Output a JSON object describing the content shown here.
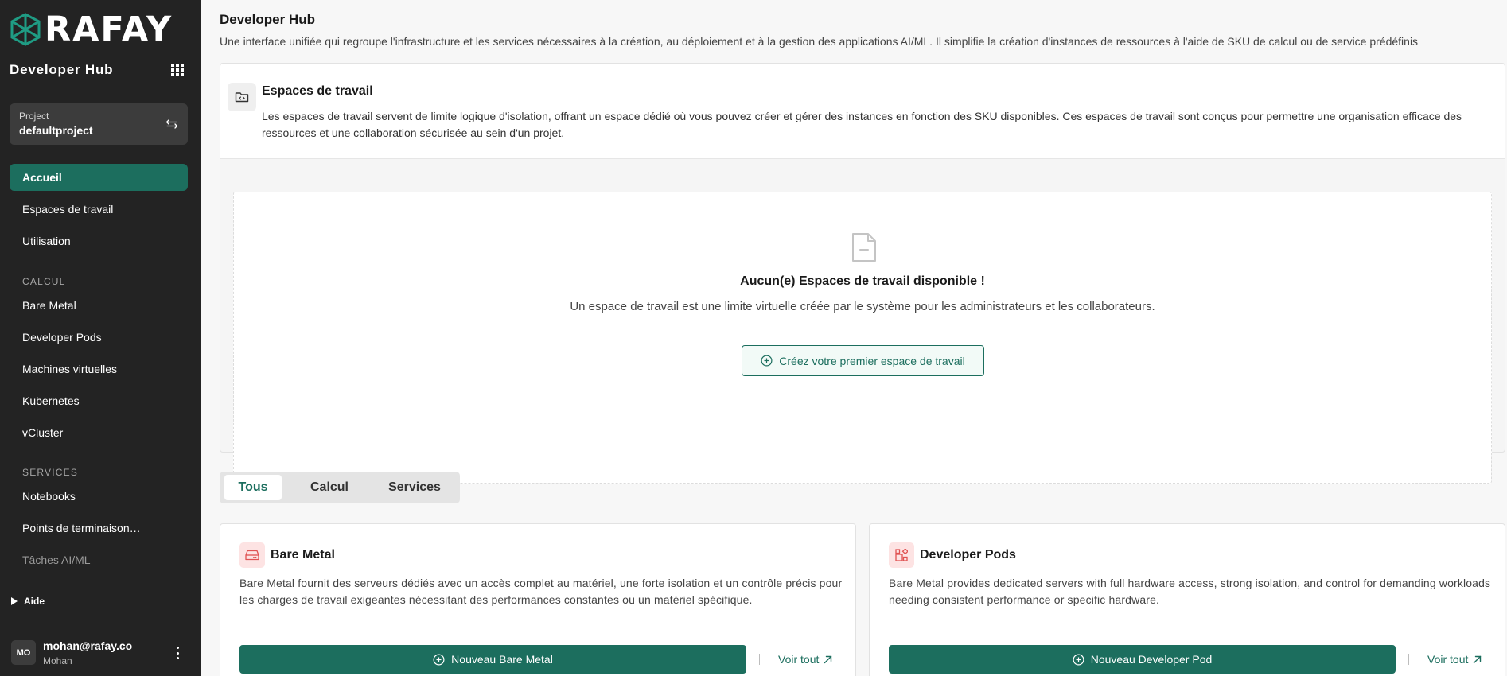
{
  "sidebar": {
    "logo_text": "RAFAY",
    "hub_title": "Developer Hub",
    "project": {
      "label": "Project",
      "value": "defaultproject"
    },
    "nav": {
      "home": "Accueil",
      "workspaces": "Espaces de travail",
      "usage": "Utilisation"
    },
    "compute_section": "CALCUL",
    "compute_items": [
      "Bare Metal",
      "Developer Pods",
      "Machines virtuelles",
      "Kubernetes",
      "vCluster"
    ],
    "services_section": "SERVICES",
    "services_items": [
      "Notebooks",
      "Points de terminaison…",
      "Tâches AI/ML"
    ],
    "help": "Aide",
    "user": {
      "initials": "MO",
      "email": "mohan@rafay.co",
      "name": "Mohan"
    }
  },
  "header": {
    "title": "Developer Hub",
    "description": "Une interface unifiée qui regroupe l'infrastructure et les services nécessaires à la création, au déploiement et à la gestion des applications AI/ML. Il simplifie la création d'instances de ressources à l'aide de SKU de calcul ou de service prédéfinis"
  },
  "workspaces": {
    "title": "Espaces de travail",
    "description": "Les espaces de travail servent de limite logique d'isolation, offrant un espace dédié où vous pouvez créer et gérer des instances en fonction des SKU disponibles. Ces espaces de travail sont conçus pour permettre une organisation efficace des ressources et une collaboration sécurisée au sein d'un projet.",
    "empty_title": "Aucun(e) Espaces de travail disponible !",
    "empty_desc": "Un espace de travail est une limite virtuelle créée par le système pour les administrateurs et les collaborateurs.",
    "create_label": "Créez votre premier espace de travail"
  },
  "tabs": [
    "Tous",
    "Calcul",
    "Services"
  ],
  "cards": [
    {
      "title": "Bare Metal",
      "description": "Bare Metal fournit des serveurs dédiés avec un accès complet au matériel, une forte isolation et un contrôle précis pour les charges de travail exigeantes nécessitant des performances constantes ou un matériel spécifique.",
      "button": "Nouveau Bare Metal",
      "link": "Voir tout"
    },
    {
      "title": "Developer Pods",
      "description": "Bare Metal provides dedicated servers with full hardware access, strong isolation, and control for demanding workloads needing consistent performance or specific hardware.",
      "button": "Nouveau Developer Pod",
      "link": "Voir tout"
    }
  ],
  "colors": {
    "sidebar_bg": "#232323",
    "accent": "#1c6e5e",
    "card_icon_bg": "#fde3e3"
  },
  "icons": [
    "rafay-logo-icon",
    "apps-grid-icon",
    "swap-icon",
    "folder-code-icon",
    "document-icon",
    "plus-circle-icon",
    "server-icon",
    "pods-icon",
    "external-arrow-icon",
    "kebab-menu-icon",
    "caret-right-icon"
  ]
}
